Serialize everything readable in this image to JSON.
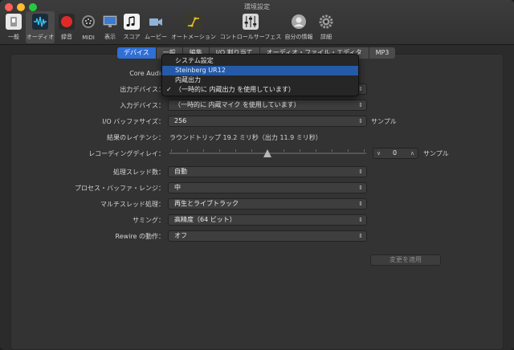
{
  "window": {
    "title": "環境設定"
  },
  "toolbar": {
    "items": [
      {
        "label": "一般",
        "icon": "general-switch-icon",
        "selected": false
      },
      {
        "label": "オーディオ",
        "icon": "audio-waveform-icon",
        "selected": true
      },
      {
        "label": "録音",
        "icon": "record-icon",
        "selected": false
      },
      {
        "label": "MIDI",
        "icon": "midi-port-icon",
        "selected": false
      },
      {
        "label": "表示",
        "icon": "display-monitor-icon",
        "selected": false
      },
      {
        "label": "スコア",
        "icon": "score-notes-icon",
        "selected": false
      },
      {
        "label": "ムービー",
        "icon": "movie-camera-icon",
        "selected": false
      },
      {
        "label": "オートメーション",
        "icon": "automation-curve-icon",
        "selected": false
      },
      {
        "label": "コントロールサーフェス",
        "icon": "control-surface-faders-icon",
        "selected": false
      },
      {
        "label": "自分の情報",
        "icon": "user-avatar-icon",
        "selected": false
      },
      {
        "label": "詳細",
        "icon": "gear-icon",
        "selected": false
      }
    ]
  },
  "tabs": [
    {
      "label": "デバイス",
      "active": true
    },
    {
      "label": "一般",
      "active": false
    },
    {
      "label": "編集",
      "active": false
    },
    {
      "label": "I/O 割り当て",
      "active": false
    },
    {
      "label": "オーディオ・ファイル・エディタ",
      "active": false
    },
    {
      "label": "MP3",
      "active": false
    }
  ],
  "device": {
    "core_audio_label": "Core Audio",
    "output_label": "出力デバイス：",
    "input_label": "入力デバイス：",
    "input_value": "（一時的に 内蔵マイク を使用しています）",
    "buffer_label": "I/O バッファサイズ：",
    "buffer_value": "256",
    "buffer_unit": "サンプル",
    "latency_label": "結果のレイテンシ：",
    "latency_value": "ラウンドトリップ 19.2 ミリ秒（出力 11.9 ミリ秒）",
    "rec_delay_label": "レコーディングディレイ：",
    "rec_delay_value": "0",
    "rec_delay_unit": "サンプル",
    "threads_label": "処理スレッド数：",
    "threads_value": "自動",
    "process_buffer_label": "プロセス・バッファ・レンジ：",
    "process_buffer_value": "中",
    "multithread_label": "マルチスレッド処理：",
    "multithread_value": "再生とライブトラック",
    "summing_label": "サミング：",
    "summing_value": "高精度（64 ビット）",
    "rewire_label": "Rewire の動作：",
    "rewire_value": "オフ",
    "apply_label": "変更を適用"
  },
  "output_menu": {
    "items": [
      {
        "label": "システム設定",
        "highlighted": false,
        "checked": false
      },
      {
        "label": "Steinberg UR12",
        "highlighted": true,
        "checked": false
      },
      {
        "label": "内蔵出力",
        "highlighted": false,
        "checked": false
      },
      {
        "label": "（一時的に 内蔵出力 を使用しています）",
        "highlighted": false,
        "checked": true
      }
    ]
  }
}
